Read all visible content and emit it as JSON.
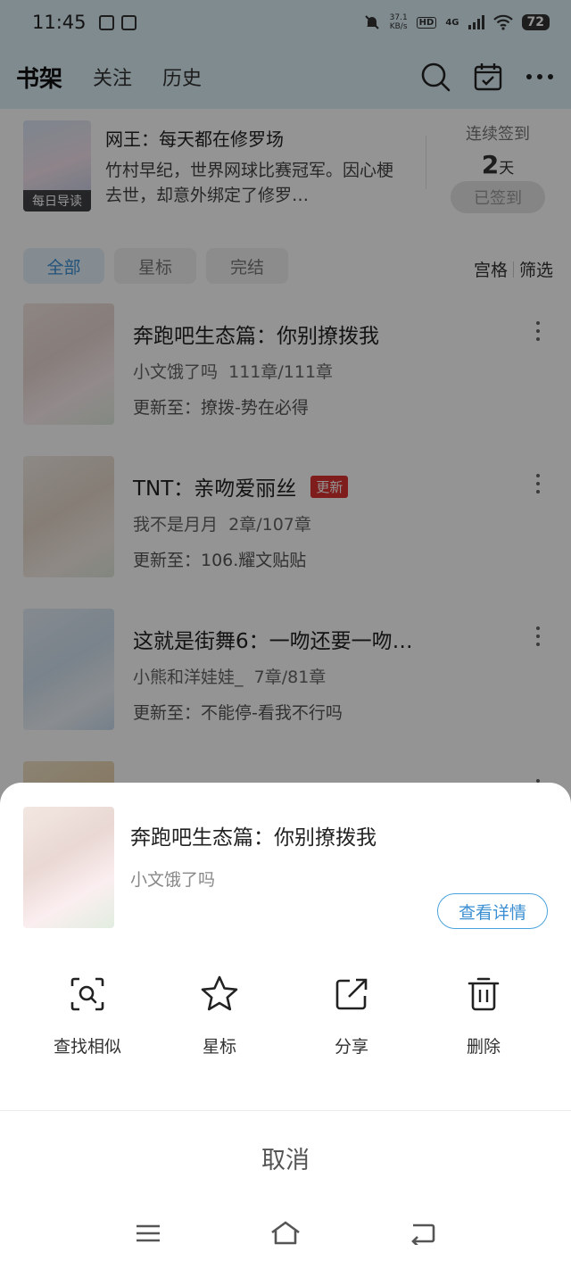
{
  "status_bar": {
    "time": "11:45",
    "net_speed_value": "37.1",
    "net_speed_unit": "KB/s",
    "hd": "HD",
    "signal": "4G",
    "battery": "72"
  },
  "top_nav": {
    "tabs": [
      "书架",
      "关注",
      "历史"
    ]
  },
  "banner": {
    "title": "网王：每天都在修罗场",
    "description": "竹村早纪，世界网球比赛冠军。因心梗去世，却意外绑定了修罗…",
    "cover_tag": "每日导读",
    "checkin_label": "连续签到",
    "checkin_days": "2",
    "checkin_unit": "天",
    "checkin_status": "已签到"
  },
  "filters": {
    "chips": [
      "全部",
      "星标",
      "完结"
    ],
    "view_mode": "宫格",
    "filter": "筛选"
  },
  "books": [
    {
      "title": "奔跑吧生态篇：你别撩拨我",
      "author": "小文饿了吗",
      "chapters": "111章/111章",
      "update": "更新至：撩拨-势在必得",
      "badge": ""
    },
    {
      "title": "TNT：亲吻爱丽丝",
      "author": "我不是月月",
      "chapters": "2章/107章",
      "update": "更新至：106.耀文贴贴",
      "badge": "更新"
    },
    {
      "title": "这就是街舞6：一吻还要一吻…",
      "author": "小熊和洋娃娃_",
      "chapters": "7章/81章",
      "update": "更新至：不能停-看我不行吗",
      "badge": ""
    }
  ],
  "sheet": {
    "title": "奔跑吧生态篇：你别撩拨我",
    "author": "小文饿了吗",
    "detail_button": "查看详情",
    "actions": [
      {
        "label": "查找相似",
        "icon": "search-similar-icon"
      },
      {
        "label": "星标",
        "icon": "star-icon"
      },
      {
        "label": "分享",
        "icon": "share-icon"
      },
      {
        "label": "删除",
        "icon": "trash-icon"
      }
    ],
    "cancel": "取消"
  },
  "colors": {
    "accent": "#3b8fd2",
    "badge_red": "#d9322f",
    "header_bg": "#ddeff8"
  }
}
